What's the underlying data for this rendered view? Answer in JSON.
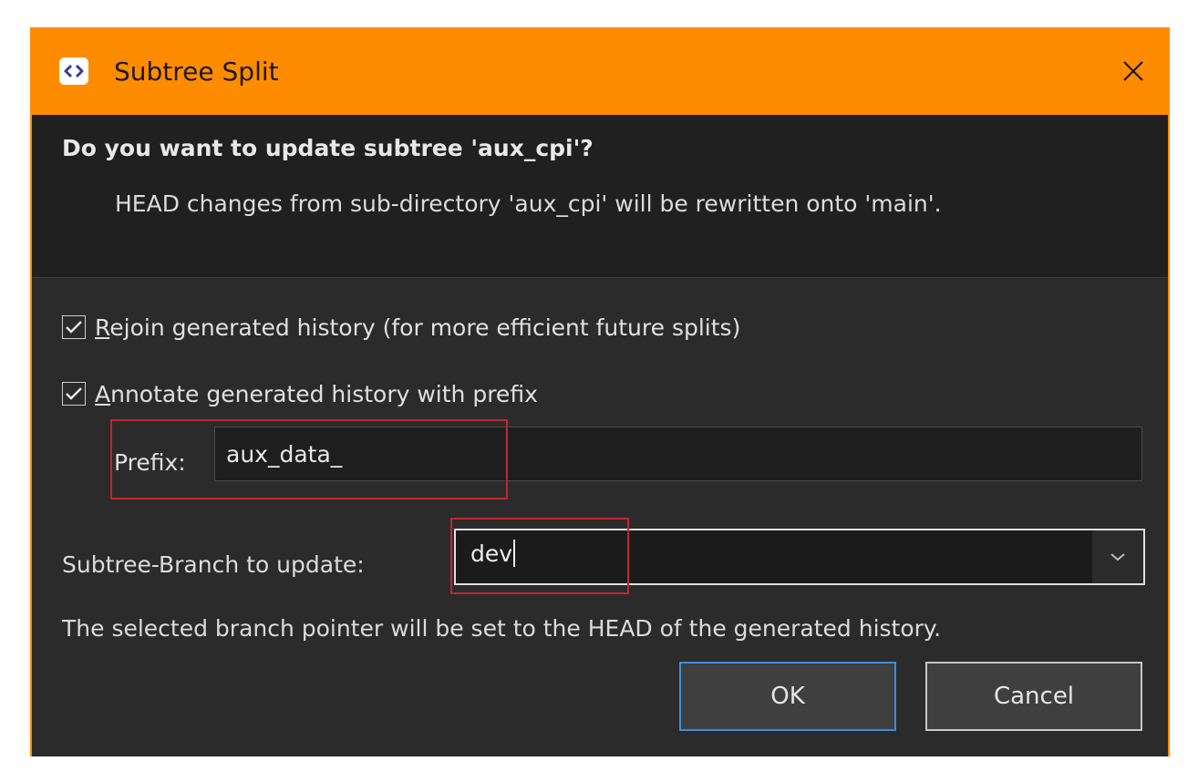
{
  "window": {
    "title": "Subtree Split",
    "app_icon": "code-brackets-icon",
    "close_icon": "close-icon",
    "accent_color": "#ff8c00"
  },
  "header": {
    "question": "Do you want to update subtree 'aux_cpi'?",
    "info": "HEAD changes from sub-directory 'aux_cpi' will be rewritten onto 'main'."
  },
  "options": {
    "rejoin": {
      "checked": true,
      "label_mnemonic": "R",
      "label_rest": "ejoin generated history (for more efficient future splits)"
    },
    "annotate": {
      "checked": true,
      "label_mnemonic": "A",
      "label_rest": "nnotate generated history with prefix"
    }
  },
  "prefix": {
    "label": "Prefix:",
    "value": "aux_data_"
  },
  "branch": {
    "label": "Subtree-Branch to update:",
    "value": "dev",
    "dropdown_icon": "chevron-down-icon"
  },
  "hint": "The selected branch pointer will be set to the HEAD of the generated history.",
  "buttons": {
    "ok": "OK",
    "cancel": "Cancel"
  }
}
